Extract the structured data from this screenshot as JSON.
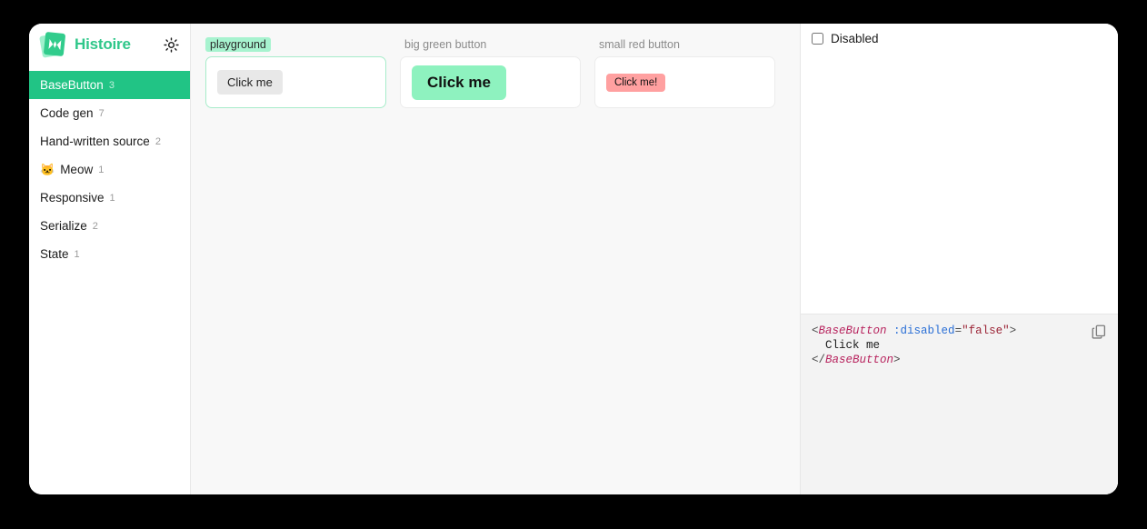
{
  "app": {
    "name": "Histoire",
    "logo_icon": "histoire-logo-icon",
    "theme_toggle_icon": "sun-icon"
  },
  "sidebar": {
    "items": [
      {
        "label": "BaseButton",
        "count": "3",
        "emoji": "",
        "active": true
      },
      {
        "label": "Code gen",
        "count": "7",
        "emoji": "",
        "active": false
      },
      {
        "label": "Hand-written source",
        "count": "2",
        "emoji": "",
        "active": false
      },
      {
        "label": "Meow",
        "count": "1",
        "emoji": "🐱",
        "active": false
      },
      {
        "label": "Responsive",
        "count": "1",
        "emoji": "",
        "active": false
      },
      {
        "label": "Serialize",
        "count": "2",
        "emoji": "",
        "active": false
      },
      {
        "label": "State",
        "count": "1",
        "emoji": "",
        "active": false
      }
    ]
  },
  "stories": [
    {
      "title": "playground",
      "highlighted": true,
      "button_label": "Click me",
      "button_style": "default"
    },
    {
      "title": "big green button",
      "highlighted": false,
      "button_label": "Click me",
      "button_style": "green"
    },
    {
      "title": "small red button",
      "highlighted": false,
      "button_label": "Click me!",
      "button_style": "red"
    }
  ],
  "controls": {
    "disabled": {
      "label": "Disabled",
      "checked": false
    }
  },
  "code": {
    "copy_icon": "copy-icon",
    "lines": [
      [
        {
          "t": "punct",
          "v": "<"
        },
        {
          "t": "tag",
          "v": "BaseButton"
        },
        {
          "t": "text",
          "v": " "
        },
        {
          "t": "attr",
          "v": ":disabled"
        },
        {
          "t": "eq",
          "v": "="
        },
        {
          "t": "str",
          "v": "\"false\""
        },
        {
          "t": "punct",
          "v": ">"
        }
      ],
      [
        {
          "t": "text",
          "v": "  Click me"
        }
      ],
      [
        {
          "t": "punct",
          "v": "</"
        },
        {
          "t": "tag",
          "v": "BaseButton"
        },
        {
          "t": "punct",
          "v": ">"
        }
      ]
    ]
  },
  "colors": {
    "brand_green": "#2fc78a",
    "active_green": "#21c485",
    "badge_green": "#a7f3cf",
    "button_green": "#8ef2bf",
    "button_red": "#ffa0a0",
    "page_bg": "#000000",
    "main_bg": "#f8f8f8"
  }
}
